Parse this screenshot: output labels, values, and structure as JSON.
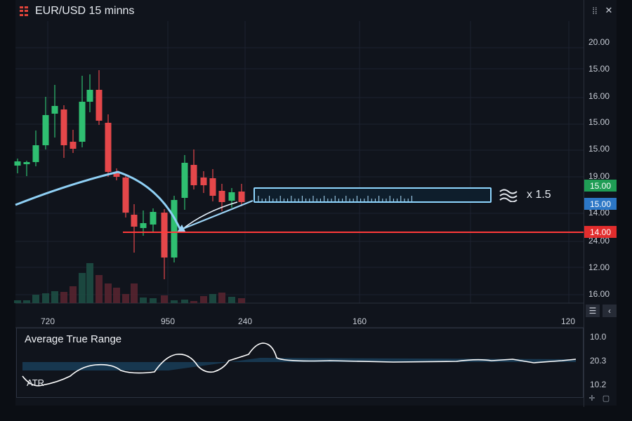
{
  "chart": {
    "title": "EUR/USD 15 minns",
    "price_labels": [
      "20.00",
      "15.00",
      "16.00",
      "15.00",
      "15.00",
      "19.00",
      "14.00",
      "24.00",
      "12.00",
      "16.00"
    ],
    "x_labels": [
      "720",
      "950",
      "240",
      "160",
      "120"
    ],
    "tags": {
      "green": "15.00",
      "blue": "15.00",
      "red": "14.00"
    },
    "scale_label": "x 1.5",
    "icons": {
      "menu": "grid-menu-icon",
      "layout": "layout-icon",
      "close": "close-icon",
      "list": "list-icon",
      "collapse": "chevron-left-icon",
      "wave": "wave-icon"
    }
  },
  "indicator": {
    "title": "Average True Range",
    "line_label": "ATR",
    "axis_labels": [
      "10.0",
      "20.3",
      "10.2"
    ]
  },
  "colors": {
    "background": "#10141c",
    "up": "#2fbf71",
    "down": "#e5474a",
    "accent_blue": "#5fb8ea",
    "support_red": "#ff3a3a"
  }
}
